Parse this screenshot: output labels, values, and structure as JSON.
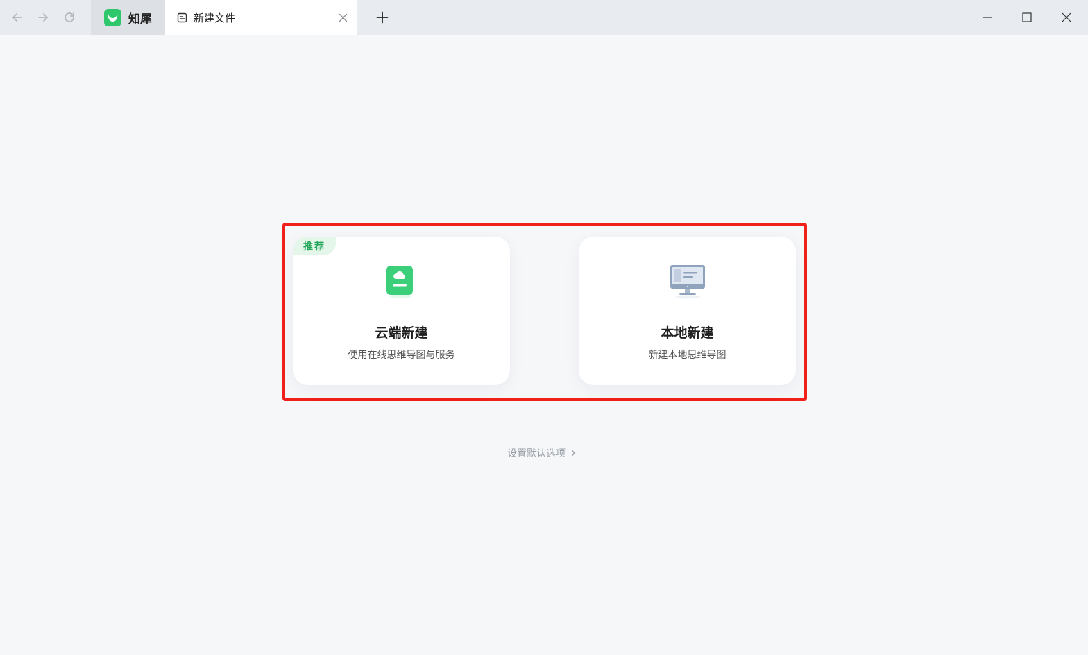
{
  "titlebar": {
    "app_tab_label": "知犀",
    "active_tab_label": "新建文件"
  },
  "main": {
    "cloud_card": {
      "badge": "推荐",
      "title": "云端新建",
      "description": "使用在线思维导图与服务"
    },
    "local_card": {
      "title": "本地新建",
      "description": "新建本地思维导图"
    },
    "settings_link": "设置默认选项"
  },
  "colors": {
    "accent_green": "#2ec76c",
    "highlight_red": "#f0211a",
    "badge_bg": "#e3f6e9"
  },
  "icons": {
    "back": "arrow-left-icon",
    "forward": "arrow-right-icon",
    "refresh": "refresh-icon",
    "app_logo": "zhixi-logo-icon",
    "document": "document-icon",
    "close_tab": "close-icon",
    "new_tab": "plus-icon",
    "cloud_file": "cloud-file-icon",
    "local_computer": "monitor-icon",
    "chevron": "chevron-right-icon"
  }
}
